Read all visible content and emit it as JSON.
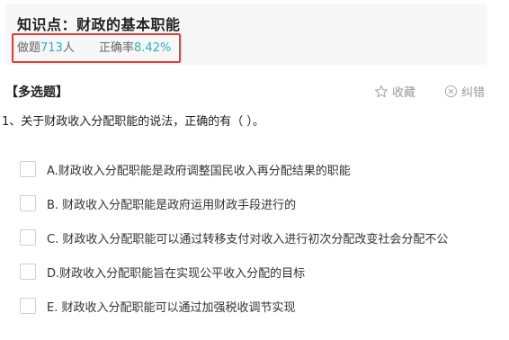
{
  "header": {
    "title": "知识点：财政的基本职能",
    "count_label": "做题",
    "count_value": "713",
    "count_unit": "人",
    "rate_label": "正确率",
    "rate_value": "8.42%"
  },
  "question": {
    "type_label": "【多选题】",
    "favorite_label": "收藏",
    "report_label": "纠错",
    "text": "1、关于财政收入分配职能的说法，正确的有（   ）。",
    "options": [
      {
        "text": "A.财政收入分配职能是政府调整国民收入再分配结果的职能"
      },
      {
        "text": "B. 财政收入分配职能是政府运用财政手段进行的"
      },
      {
        "text": "C. 财政收入分配职能可以通过转移支付对收入进行初次分配改变社会分配不公"
      },
      {
        "text": "D.财政收入分配职能旨在实现公平收入分配的目标"
      },
      {
        "text": "E. 财政收入分配职能可以通过加强税收调节实现"
      }
    ]
  },
  "colors": {
    "accent": "#2bb3c0",
    "highlight_border": "#e53935"
  },
  "icons": {
    "favorite": "star-outline-icon",
    "report": "circle-x-icon"
  }
}
